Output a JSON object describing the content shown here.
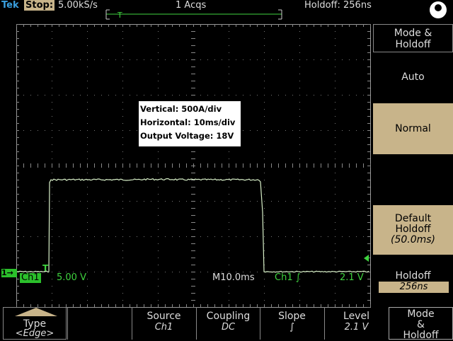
{
  "header": {
    "brand": "Tek",
    "state": "Stop:",
    "sample_rate": "5.00kS/s",
    "acquisitions": "1 Acqs",
    "holdoff": "Holdoff: 256ns",
    "trigger_position": "T"
  },
  "info_box": {
    "vertical": "Vertical: 500A/div",
    "horizontal": "Horizontal: 10ms/div",
    "output": "Output Voltage: 18V"
  },
  "readouts": {
    "channel_marker": "1→",
    "trigger_marker": "T",
    "channel": "Ch1",
    "channel_scale": "5.00 V",
    "timebase": "M10.0ms",
    "trigger_channel": "Ch1 ∫",
    "trigger_level": "2.1 V"
  },
  "side_menu": {
    "title_line1": "Mode &",
    "title_line2": "Holdoff",
    "auto": "Auto",
    "normal": "Normal",
    "default_line1": "Default",
    "default_line2": "Holdoff",
    "default_value": "(50.0ms)",
    "holdoff_label": "Holdoff",
    "holdoff_value": "256ns"
  },
  "bottom_menu": {
    "type_label": "Type",
    "type_value": "<Edge>",
    "source_label": "Source",
    "source_value": "Ch1",
    "coupling_label": "Coupling",
    "coupling_value": "DC",
    "slope_label": "Slope",
    "slope_value": "∫",
    "level_label": "Level",
    "level_value": "2.1 V",
    "mode_line1": "Mode",
    "mode_line2": "&",
    "mode_line3": "Holdoff"
  },
  "colors": {
    "trace": "#d8f0c8",
    "channel": "#2bc02b",
    "highlight": "#c8b48a",
    "brand": "#3aa0e0"
  }
}
